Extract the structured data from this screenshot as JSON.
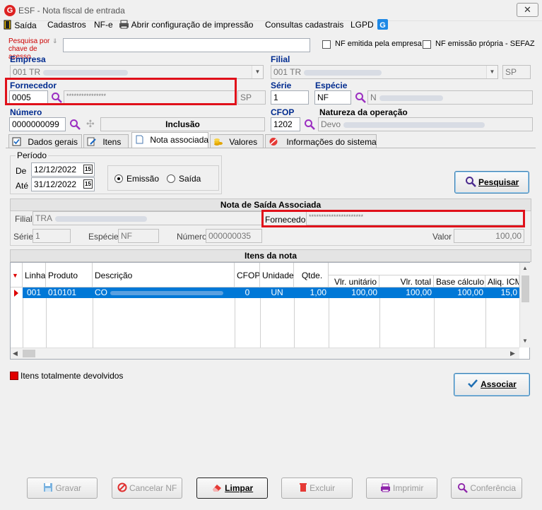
{
  "window": {
    "title": "ESF - Nota fiscal de entrada",
    "close_glyph": "✕"
  },
  "menu": {
    "items": [
      "Saída",
      "Cadastros",
      "NF-e",
      "Abrir configuração de impressão",
      "Consultas cadastrais",
      "LGPD"
    ]
  },
  "search": {
    "label": "Pesquisa por chave de acesso",
    "value": "",
    "nf_emitida_label": "NF emitida pela empresa",
    "nf_propria_label": "NF emissão própria - SEFAZ"
  },
  "empresa": {
    "label": "Empresa",
    "value": "001 TR"
  },
  "filial": {
    "label": "Filial",
    "value": "001 TR",
    "uf": "SP"
  },
  "fornecedor": {
    "label": "Fornecedor",
    "code": "0005",
    "name": "****************",
    "uf": "SP"
  },
  "serie": {
    "label": "Série",
    "value": "1"
  },
  "especie": {
    "label": "Espécie",
    "value": "NF",
    "desc": "N"
  },
  "numero": {
    "label": "Número",
    "value": "0000000099",
    "status": "Inclusão"
  },
  "cfop": {
    "label": "CFOP",
    "value": "1202"
  },
  "natureza": {
    "label": "Natureza da operação",
    "value": "Devo"
  },
  "tabs": [
    "Dados gerais",
    "Itens",
    "Nota associada",
    "Valores",
    "Informações do sistema"
  ],
  "periodo": {
    "label": "Período",
    "de_label": "De",
    "de_value": "12/12/2022",
    "ate_label": "Até",
    "ate_value": "31/12/2022",
    "cal_glyph": "15",
    "emissao_label": "Emissão",
    "saida_label": "Saída",
    "selected": "Emissão"
  },
  "pesquisar_label": "Pesquisar",
  "nota_saida": {
    "header": "Nota de Saída Associada",
    "filial_label": "Filial",
    "filial_value": "TRA",
    "fornecedor_label": "Fornecedor",
    "fornecedor_value": "**********************",
    "serie_label": "Série",
    "serie_value": "1",
    "especie_label": "Espécie",
    "especie_value": "NF",
    "numero_label": "Número",
    "numero_value": "000000035",
    "valor_label": "Valor",
    "valor_value": "100,00"
  },
  "itens": {
    "header": "Itens da nota",
    "columns": [
      "Linha",
      "Produto",
      "Descrição",
      "CFOP",
      "Unidade",
      "Qtde.",
      "Vlr. unitário",
      "Vlr. total",
      "Base cálculo",
      "Aliq. ICM"
    ],
    "rows": [
      {
        "linha": "001",
        "produto": "010101",
        "descricao": "CO",
        "cfop": "0",
        "unidade": "UN",
        "qtde": "1,00",
        "vlr_unitario": "100,00",
        "vlr_total": "100,00",
        "base_calculo": "100,00",
        "aliq_icm": "15,0"
      }
    ]
  },
  "legend": {
    "label": "Itens totalmente devolvidos",
    "color": "#e00000"
  },
  "associar_label": "Associar",
  "buttons": {
    "gravar": "Gravar",
    "cancelar": "Cancelar NF",
    "limpar": "Limpar",
    "excluir": "Excluir",
    "imprimir": "Imprimir",
    "conferencia": "Conferência"
  },
  "colors": {
    "selection": "#0078d7",
    "highlight": "#e0101a",
    "label_blue": "#002b8f",
    "search_label": "#cc0000"
  }
}
